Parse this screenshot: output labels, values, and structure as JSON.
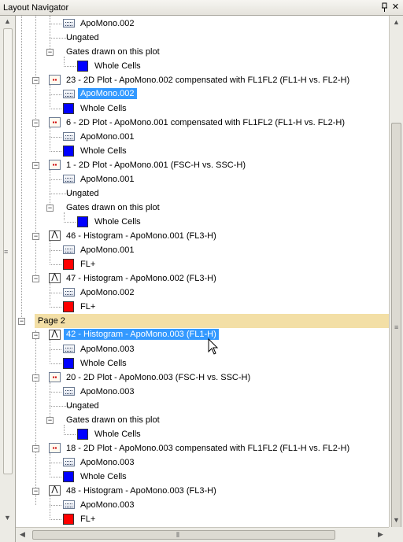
{
  "window": {
    "title": "Layout Navigator",
    "pin_glyph": " ",
    "close_glyph": "✕"
  },
  "tree": {
    "plot_23_label": "23 - 2D Plot - ApoMono.002 compensated with FL1FL2 (FL1-H vs. FL2-H)",
    "plot_6_label": "6 - 2D Plot - ApoMono.001 compensated with FL1FL2 (FL1-H vs. FL2-H)",
    "plot_1_label": "1 - 2D Plot - ApoMono.001 (FSC-H vs. SSC-H)",
    "hist_46_label": "46 - Histogram - ApoMono.001 (FL3-H)",
    "hist_47_label": "47 - Histogram - ApoMono.002 (FL3-H)",
    "page2_label": "Page 2",
    "hist_42_label": "42 - Histogram - ApoMono.003 (FL1-H)",
    "plot_20_label": "20 - 2D Plot - ApoMono.003 (FSC-H vs. SSC-H)",
    "plot_18_label": "18 - 2D Plot - ApoMono.003 compensated with FL1FL2 (FL1-H vs. FL2-H)",
    "hist_48_label": "48 - Histogram - ApoMono.003 (FL3-H)",
    "apomono_001": "ApoMono.001",
    "apomono_002": "ApoMono.002",
    "apomono_003": "ApoMono.003",
    "ungated": "Ungated",
    "gates_drawn": "Gates drawn on this plot",
    "whole_cells": "Whole Cells",
    "fl_plus": "FL+"
  },
  "colors": {
    "whole_cells_swatch": "#0000ff",
    "fl_plus_swatch": "#ff0000",
    "selection": "#3399ff",
    "page_header": "#f3dfa6"
  },
  "icons": {
    "data_file": "data-file-icon",
    "plot_2d": "2d-plot-icon",
    "histogram": "histogram-icon",
    "expander": "collapse-icon"
  }
}
